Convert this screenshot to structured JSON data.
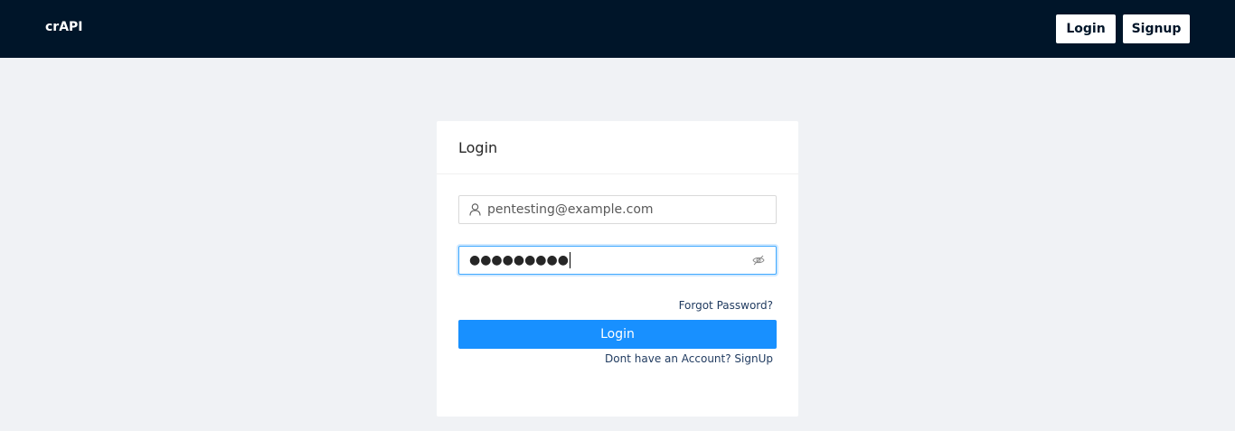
{
  "header": {
    "brand": "crAPI",
    "login_label": "Login",
    "signup_label": "Signup"
  },
  "login_card": {
    "title": "Login",
    "email": {
      "value": "pentesting@example.com",
      "icon": "user-icon"
    },
    "password": {
      "masked_value": "●●●●●●●●●",
      "icon": "eye-invisible-icon"
    },
    "forgot_password": "Forgot Password?",
    "submit_label": "Login",
    "signup_prompt": "Dont have an Account? SignUp"
  },
  "colors": {
    "header_bg": "#001529",
    "page_bg": "#f0f2f5",
    "primary": "#1890ff",
    "link": "#1f3a5f"
  }
}
